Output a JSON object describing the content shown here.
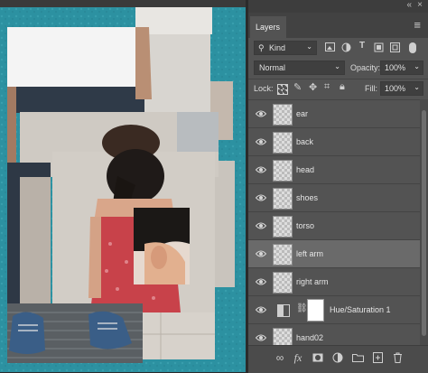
{
  "panel": {
    "collapse_glyph": "«",
    "close_glyph": "×",
    "tab_label": "Layers",
    "menu_glyph": "≡",
    "filter": {
      "kind_label": "Kind",
      "icon_names": [
        "image-filter-icon",
        "adjustment-filter-icon",
        "type-filter-icon",
        "shape-filter-icon",
        "smart-object-filter-icon"
      ]
    },
    "blend_mode": "Normal",
    "opacity_label": "Opacity:",
    "opacity_value": "100%",
    "lock_label": "Lock:",
    "fill_label": "Fill:",
    "fill_value": "100%",
    "layers": [
      {
        "name": "ear",
        "visible": true,
        "selected": false,
        "type": "pixel"
      },
      {
        "name": "back",
        "visible": true,
        "selected": false,
        "type": "pixel"
      },
      {
        "name": "head",
        "visible": true,
        "selected": false,
        "type": "pixel"
      },
      {
        "name": "shoes",
        "visible": true,
        "selected": false,
        "type": "pixel"
      },
      {
        "name": "torso",
        "visible": true,
        "selected": false,
        "type": "pixel"
      },
      {
        "name": "left arm",
        "visible": true,
        "selected": true,
        "type": "pixel"
      },
      {
        "name": "right arm",
        "visible": true,
        "selected": false,
        "type": "pixel"
      },
      {
        "name": "Hue/Saturation 1",
        "visible": true,
        "selected": false,
        "type": "adjustment"
      },
      {
        "name": "hand02",
        "visible": true,
        "selected": false,
        "type": "pixel"
      }
    ],
    "footer": {
      "link_glyph": "∞",
      "fx_label": "fx"
    }
  },
  "colors": {
    "canvas_bg": "#2a8fa0",
    "panel_bg": "#535353",
    "selected_row": "#6a6a6a",
    "dress": "#c8424a"
  }
}
